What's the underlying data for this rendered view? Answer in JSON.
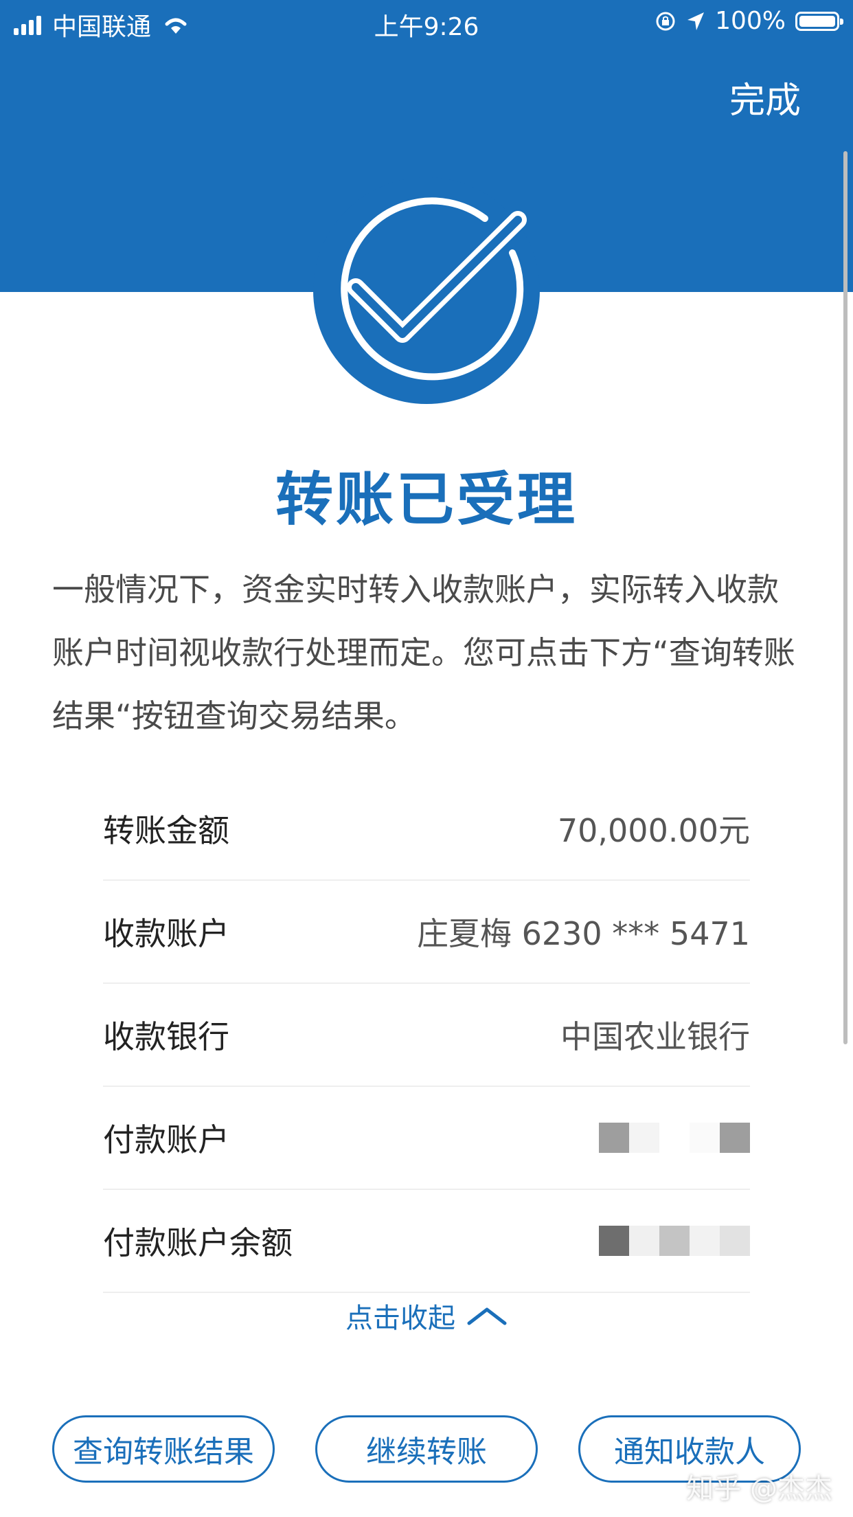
{
  "status_bar": {
    "carrier": "中国联通",
    "time": "上午9:26",
    "battery_percent": "100%",
    "icons": [
      "signal-icon",
      "wifi-icon",
      "rotation-lock-icon",
      "location-icon",
      "battery-icon"
    ]
  },
  "header": {
    "done_label": "完成"
  },
  "result": {
    "title": "转账已受理",
    "description": "一般情况下，资金实时转入收款账户，实际转入收款账户时间视收款行处理而定。您可点击下方“查询转账结果“按钮查询交易结果。",
    "icon": "check-circle-icon"
  },
  "details": [
    {
      "label": "转账金额",
      "value": "70,000.00元"
    },
    {
      "label": "收款账户",
      "value": "庄夏梅 6230 *** 5471"
    },
    {
      "label": "收款银行",
      "value": "中国农业银行"
    },
    {
      "label": "付款账户",
      "value": ""
    },
    {
      "label": "付款账户余额",
      "value": ""
    }
  ],
  "collapse": {
    "label": "点击收起",
    "icon": "chevron-up-icon"
  },
  "actions": {
    "query_label": "查询转账结果",
    "continue_label": "继续转账",
    "notify_label": "通知收款人"
  },
  "watermark": "知乎 @杰杰",
  "colors": {
    "brand_blue": "#1a6fba",
    "background": "#ffffff"
  }
}
